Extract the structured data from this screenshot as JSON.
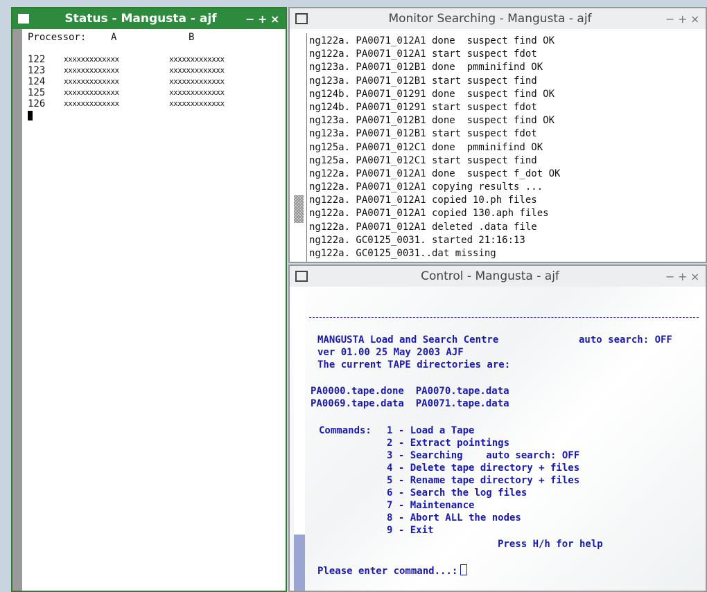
{
  "status_window": {
    "title": "Status  - Mangusta - ajf",
    "controls": [
      "−",
      "+",
      "×"
    ],
    "header_label": "Processor:",
    "col_a": "A",
    "col_b": "B",
    "rows": [
      {
        "num": "122",
        "a": "xxxxxxxxxxxxx",
        "b": "xxxxxxxxxxxxx"
      },
      {
        "num": "123",
        "a": "xxxxxxxxxxxxx",
        "b": "xxxxxxxxxxxxx"
      },
      {
        "num": "124",
        "a": "xxxxxxxxxxxxx",
        "b": "xxxxxxxxxxxxx"
      },
      {
        "num": "125",
        "a": "xxxxxxxxxxxxx",
        "b": "xxxxxxxxxxxxx"
      },
      {
        "num": "126",
        "a": "xxxxxxxxxxxxx",
        "b": "xxxxxxxxxxxxx"
      }
    ]
  },
  "monitor_window": {
    "title": "Monitor Searching - Mangusta - ajf",
    "controls": [
      "−",
      "+",
      "×"
    ],
    "lines": [
      "ng122a. PA0071_012A1 done  suspect find OK",
      "ng122a. PA0071_012A1 start suspect fdot",
      "ng123a. PA0071_012B1 done  pmminifind OK",
      "ng123a. PA0071_012B1 start suspect find",
      "ng124b. PA0071_01291 done  suspect find OK",
      "ng124b. PA0071_01291 start suspect fdot",
      "ng123a. PA0071_012B1 done  suspect find OK",
      "ng123a. PA0071_012B1 start suspect fdot",
      "ng125a. PA0071_012C1 done  pmminifind OK",
      "ng125a. PA0071_012C1 start suspect find",
      "ng122a. PA0071_012A1 done  suspect f_dot OK",
      "ng122a. PA0071_012A1 copying results ...",
      "ng122a. PA0071_012A1 copied 10.ph files",
      "ng122a. PA0071_012A1 copied 130.aph files",
      "ng122a. PA0071_012A1 deleted .data file",
      "ng122a. GC0125_0031. started 21:16:13",
      "ng122a. GC0125_0031..dat missing"
    ]
  },
  "control_window": {
    "title": "Control - Mangusta - ajf",
    "controls": [
      "−",
      "+",
      "×"
    ],
    "heading": "MANGUSTA Load and Search Centre",
    "auto_search_label": "auto search: OFF",
    "version": "ver 01.00 25 May 2003 AJF",
    "dirs_intro": "The current TAPE directories are:",
    "dirs_row1": "PA0000.tape.done  PA0070.tape.data",
    "dirs_row2": "PA0069.tape.data  PA0071.tape.data",
    "commands_label": "Commands:",
    "commands": [
      "1 - Load a Tape",
      "2 - Extract pointings",
      "3 - Searching    auto search: OFF",
      "4 - Delete tape directory + files",
      "5 - Rename tape directory + files",
      "6 - Search the log files",
      "7 - Maintenance",
      "8 - Abort ALL the nodes",
      "9 - Exit"
    ],
    "help_hint": "Press H/h for help",
    "prompt": "Please enter command...:"
  }
}
